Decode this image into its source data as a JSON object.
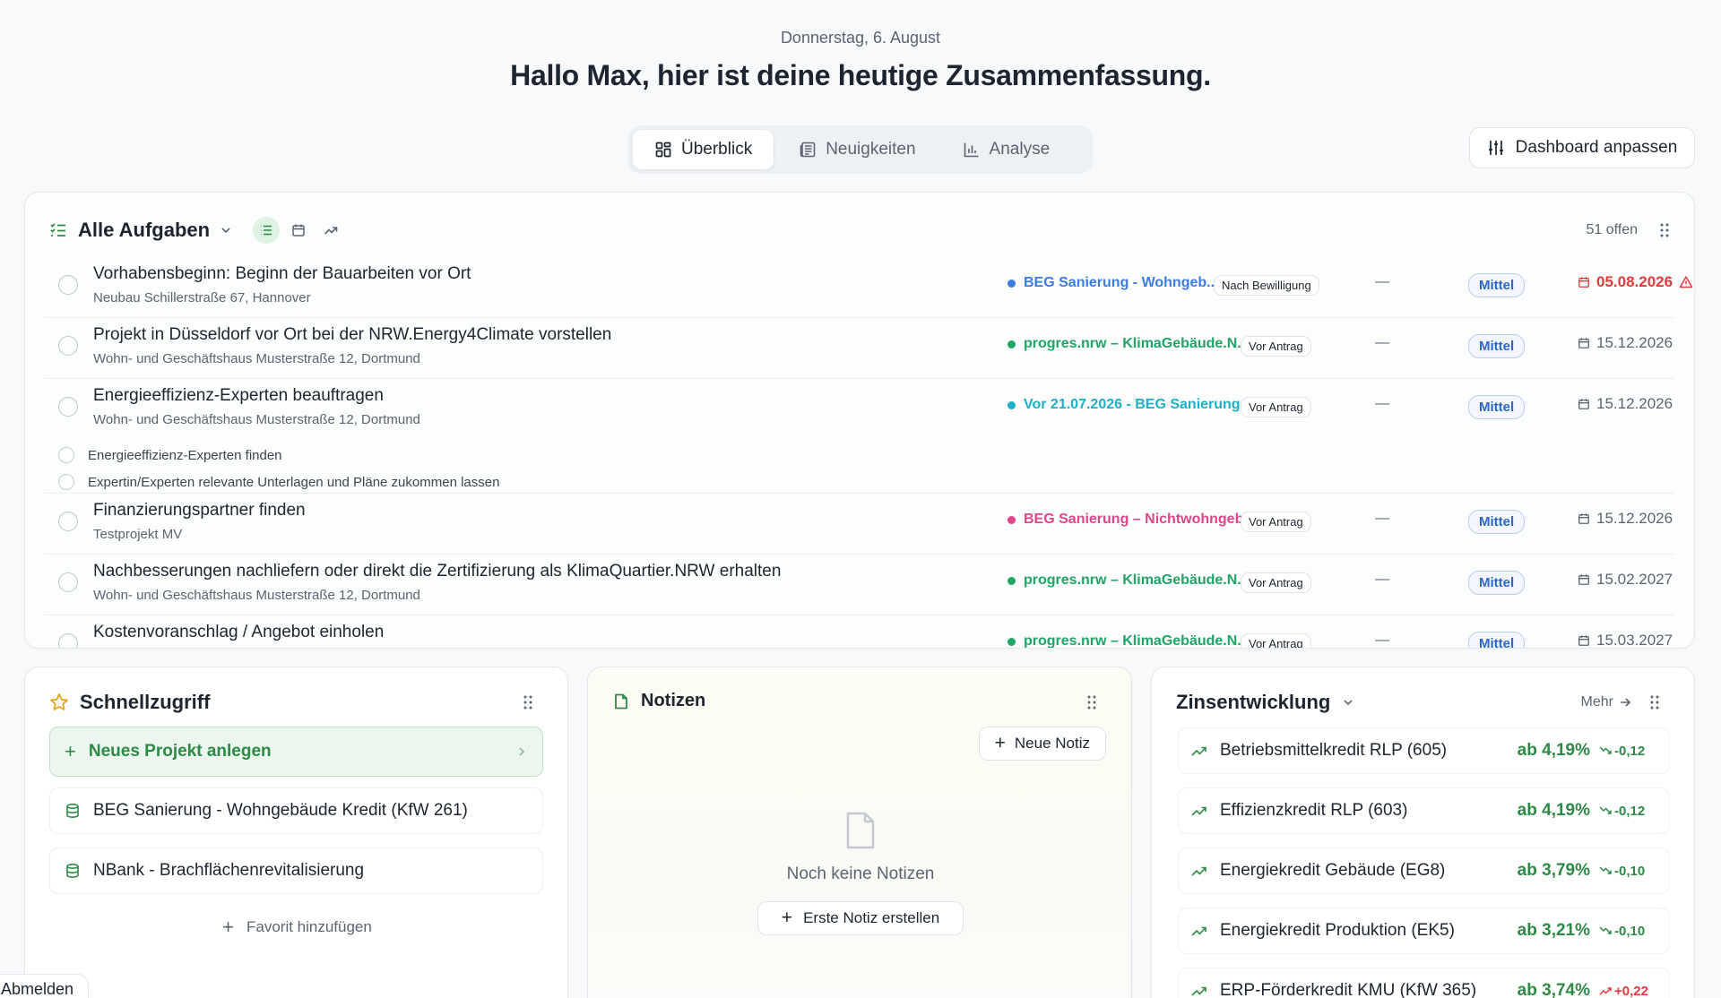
{
  "header": {
    "date": "Donnerstag, 6. August",
    "greeting": "Hallo Max, hier ist deine heutige Zusammenfassung."
  },
  "tabs": [
    {
      "label": "Überblick",
      "active": true,
      "icon": "grid-icon"
    },
    {
      "label": "Neuigkeiten",
      "active": false,
      "icon": "newspaper-icon"
    },
    {
      "label": "Analyse",
      "active": false,
      "icon": "bar-chart-icon"
    }
  ],
  "customize_button": "Dashboard anpassen",
  "tasks": {
    "title": "Alle Aufgaben",
    "open_count": "51 offen",
    "items": [
      {
        "title": "Vorhabensbeginn: Beginn der Bauarbeiten vor Ort",
        "subtitle": "Neubau Schillerstraße 67, Hannover",
        "program": "BEG Sanierung - Wohngeb...",
        "program_color": "#3b7ce0",
        "phase": "Nach Bewilligung",
        "assignee": "—",
        "priority": "Mittel",
        "due": "05.08.2026",
        "overdue": true
      },
      {
        "title": "Projekt in Düsseldorf vor Ort bei der NRW.Energy4Climate vorstellen",
        "subtitle": "Wohn- und Geschäftshaus Musterstraße 12, Dortmund",
        "program": "progres.nrw – KlimaGebäude.N...",
        "program_color": "#1fa566",
        "phase": "Vor Antrag",
        "assignee": "—",
        "priority": "Mittel",
        "due": "15.12.2026",
        "overdue": false
      },
      {
        "title": "Energieeffizienz-Experten beauftragen",
        "subtitle": "Wohn- und Geschäftshaus Musterstraße 12, Dortmund",
        "program": "Vor 21.07.2026 - BEG Sanierung ...",
        "program_color": "#1bb0c8",
        "phase": "Vor Antrag",
        "assignee": "—",
        "priority": "Mittel",
        "due": "15.12.2026",
        "overdue": false,
        "subtasks": [
          "Energieeffizienz-Experten finden",
          "Expertin/Experten relevante Unterlagen und Pläne zukommen lassen"
        ]
      },
      {
        "title": "Finanzierungspartner finden",
        "subtitle": "Testprojekt MV",
        "program": "BEG Sanierung – Nichtwohngeb...",
        "program_color": "#e0448a",
        "phase": "Vor Antrag",
        "assignee": "—",
        "priority": "Mittel",
        "due": "15.12.2026",
        "overdue": false
      },
      {
        "title": "Nachbesserungen nachliefern oder direkt die Zertifizierung als KlimaQuartier.NRW erhalten",
        "subtitle": "Wohn- und Geschäftshaus Musterstraße 12, Dortmund",
        "program": "progres.nrw – KlimaGebäude.N...",
        "program_color": "#1fa566",
        "phase": "Vor Antrag",
        "assignee": "—",
        "priority": "Mittel",
        "due": "15.02.2027",
        "overdue": false
      },
      {
        "title": "Kostenvoranschlag / Angebot einholen",
        "subtitle": "",
        "program": "progres.nrw – KlimaGebäude.N...",
        "program_color": "#1fa566",
        "phase": "Vor Antrag",
        "assignee": "—",
        "priority": "Mittel",
        "due": "15.03.2027",
        "overdue": false
      }
    ]
  },
  "quick_access": {
    "title": "Schnellzugriff",
    "new_project": "Neues Projekt anlegen",
    "favorites": [
      "BEG Sanierung - Wohngebäude Kredit (KfW 261)",
      "NBank - Brachflächenrevitalisierung"
    ],
    "add_favorite": "Favorit hinzufügen"
  },
  "notes": {
    "title": "Notizen",
    "new_note": "Neue Notiz",
    "empty_text": "Noch keine Notizen",
    "first_note": "Erste Notiz erstellen"
  },
  "rates": {
    "title": "Zinsentwicklung",
    "more": "Mehr",
    "items": [
      {
        "name": "Betriebsmittelkredit RLP (605)",
        "rate": "ab 4,19%",
        "change": "-0,12",
        "direction": "down"
      },
      {
        "name": "Effizienzkredit RLP (603)",
        "rate": "ab 4,19%",
        "change": "-0,12",
        "direction": "down"
      },
      {
        "name": "Energiekredit Gebäude (EG8)",
        "rate": "ab 3,79%",
        "change": "-0,10",
        "direction": "down"
      },
      {
        "name": "Energiekredit Produktion (EK5)",
        "rate": "ab 3,21%",
        "change": "-0,10",
        "direction": "down"
      },
      {
        "name": "ERP-Förderkredit KMU (KfW 365)",
        "rate": "ab 3,74%",
        "change": "+0,22",
        "direction": "up"
      }
    ]
  },
  "logout": "Abmelden",
  "colors": {
    "accent_green": "#2c8a45",
    "accent_blue": "#2b66c9",
    "danger": "#e03b3b"
  }
}
